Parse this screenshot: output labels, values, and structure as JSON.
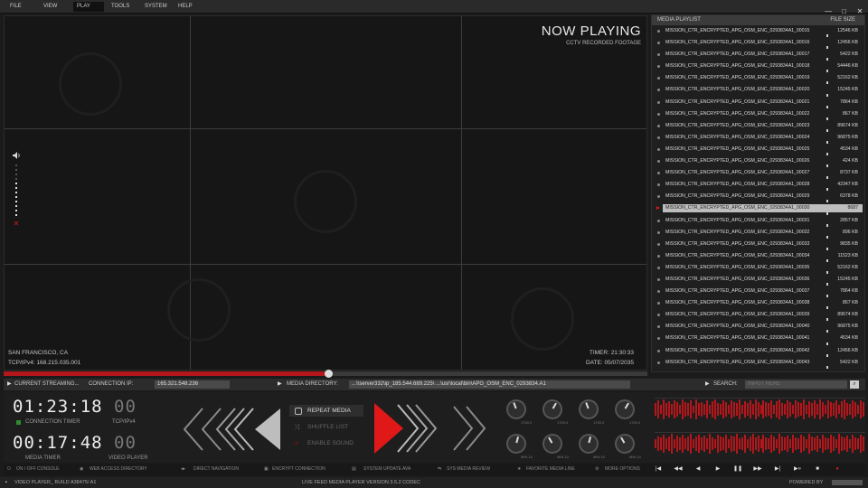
{
  "menu": [
    "FILE",
    "VIEW",
    "PLAY",
    "TOOLS",
    "SYSTEM",
    "HELP"
  ],
  "window_controls": [
    "—",
    "□",
    "✕"
  ],
  "now_playing": {
    "title": "NOW PLAYING",
    "subtitle": "CCTV RECORDED FOOTAGE"
  },
  "location": {
    "city": "SAN FRANCISCO, CA",
    "ip": "TCP/IPv4: 168.215.035.001"
  },
  "overlay_time": {
    "timer": "TIMER:   21:30:33",
    "date": "DATE:   05/07/2035"
  },
  "seek": {
    "progress": 0.504
  },
  "playlist": {
    "header": "MEDIA PLAYLIST",
    "size_header": "FILE SIZE",
    "selected_index": 15,
    "items": [
      {
        "name": "MISSION_CTR_ENCRYPTED_APG_OSM_ENC_0293834A1_00015",
        "size": "12546 KB"
      },
      {
        "name": "MISSION_CTR_ENCRYPTED_APG_OSM_ENC_0293834A1_00016",
        "size": "12456 KB"
      },
      {
        "name": "MISSION_CTR_ENCRYPTED_APG_OSM_ENC_0293834A1_00017",
        "size": "5422 KB"
      },
      {
        "name": "MISSION_CTR_ENCRYPTED_APG_OSM_ENC_0293834A1_00018",
        "size": "54446 KB"
      },
      {
        "name": "MISSION_CTR_ENCRYPTED_APG_OSM_ENC_0293834A1_00019",
        "size": "52162 KB"
      },
      {
        "name": "MISSION_CTR_ENCRYPTED_APG_OSM_ENC_0293834A1_00020",
        "size": "15245 KB"
      },
      {
        "name": "MISSION_CTR_ENCRYPTED_APG_OSM_ENC_0293834A1_00021",
        "size": "7864 KB"
      },
      {
        "name": "MISSION_CTR_ENCRYPTED_APG_OSM_ENC_0293834A1_00022",
        "size": "867 KB"
      },
      {
        "name": "MISSION_CTR_ENCRYPTED_APG_OSM_ENC_0293834A1_00023",
        "size": "89674 KB"
      },
      {
        "name": "MISSION_CTR_ENCRYPTED_APG_OSM_ENC_0293834A1_00024",
        "size": "96875 KB"
      },
      {
        "name": "MISSION_CTR_ENCRYPTED_APG_OSM_ENC_0293834A1_00025",
        "size": "4534 KB"
      },
      {
        "name": "MISSION_CTR_ENCRYPTED_APG_OSM_ENC_0293834A1_00026",
        "size": "424 KB"
      },
      {
        "name": "MISSION_CTR_ENCRYPTED_APG_OSM_ENC_0293834A1_00027",
        "size": "8737 KB"
      },
      {
        "name": "MISSION_CTR_ENCRYPTED_APG_OSM_ENC_0293834A1_00028",
        "size": "42347 KB"
      },
      {
        "name": "MISSION_CTR_ENCRYPTED_APG_OSM_ENC_0293834A1_00029",
        "size": "6378 KB"
      },
      {
        "name": "MISSION_CTR_ENCRYPTED_APG_OSM_ENC_0293834A1_00030",
        "size": "8687"
      },
      {
        "name": "MISSION_CTR_ENCRYPTED_APG_OSM_ENC_0293834A1_00031",
        "size": "2857 KB"
      },
      {
        "name": "MISSION_CTR_ENCRYPTED_APG_OSM_ENC_0293834A1_00032",
        "size": "896 KB"
      },
      {
        "name": "MISSION_CTR_ENCRYPTED_APG_OSM_ENC_0293834A1_00033",
        "size": "9835 KB"
      },
      {
        "name": "MISSION_CTR_ENCRYPTED_APG_OSM_ENC_0293834A1_00034",
        "size": "11523 KB"
      },
      {
        "name": "MISSION_CTR_ENCRYPTED_APG_OSM_ENC_0293834A1_00035",
        "size": "52162 KB"
      },
      {
        "name": "MISSION_CTR_ENCRYPTED_APG_OSM_ENC_0293834A1_00036",
        "size": "15245 KB"
      },
      {
        "name": "MISSION_CTR_ENCRYPTED_APG_OSM_ENC_0293834A1_00037",
        "size": "7864 KB"
      },
      {
        "name": "MISSION_CTR_ENCRYPTED_APG_OSM_ENC_0293834A1_00038",
        "size": "867 KB"
      },
      {
        "name": "MISSION_CTR_ENCRYPTED_APG_OSM_ENC_0293834A1_00039",
        "size": "89674 KB"
      },
      {
        "name": "MISSION_CTR_ENCRYPTED_APG_OSM_ENC_0293834A1_00040",
        "size": "96875 KB"
      },
      {
        "name": "MISSION_CTR_ENCRYPTED_APG_OSM_ENC_0293834A1_00041",
        "size": "4534 KB"
      },
      {
        "name": "MISSION_CTR_ENCRYPTED_APG_OSM_ENC_0293834A1_00042",
        "size": "12456 KB"
      },
      {
        "name": "MISSION_CTR_ENCRYPTED_APG_OSM_ENC_0293834A1_00043",
        "size": "5422 KB"
      }
    ]
  },
  "infobar": {
    "streaming_label": "CURRENT STREAMING...",
    "connection_label": "CONNECTION IP:",
    "connection_ip": "165.321.548.236",
    "directory_label": "MEDIA DIRECTORY:",
    "directory_path": "...\\\\server332\\ip_185.544.689.225\\ ...\\usr\\local\\bin\\APG_OSM_ENC_0293834.A1",
    "search_label": "SEARCH:",
    "search_placeholder": "INPUT HERE"
  },
  "timers": {
    "connection": {
      "h": "01",
      "m": "23",
      "s": "18",
      "f": "00",
      "label": "CONNECTION TIMER",
      "proto": "TCP/IPv4"
    },
    "media": {
      "h": "00",
      "m": "17",
      "s": "48",
      "f": "00",
      "label": "MEDIA TIMER",
      "player": "VIDEO PLAYER"
    }
  },
  "options": [
    {
      "label": "REPEAT MEDIA",
      "icon": "repeat-icon",
      "enabled": true
    },
    {
      "label": "SHUFFLE LIST",
      "icon": "shuffle-icon",
      "enabled": false
    },
    {
      "label": "ENABLE SOUND",
      "icon": "sound-icon",
      "enabled": false
    }
  ],
  "knobs_top": [
    "1700.0",
    "1700.0",
    "1700.0",
    "1700.0"
  ],
  "knobs_bottom": [
    "MIN 10",
    "MIN 10",
    "MIN 10",
    "MIN 10"
  ],
  "wave_top": [
    0.55,
    0.8,
    0.4,
    0.9,
    0.6,
    0.75,
    0.5,
    0.85,
    0.65,
    0.45,
    0.9,
    0.7,
    0.55,
    0.8,
    0.35,
    0.95,
    0.6,
    0.7,
    0.5,
    0.85,
    0.4,
    0.75,
    0.9,
    0.6,
    0.5,
    0.8,
    0.65,
    0.45,
    0.85,
    0.7,
    0.55,
    0.9,
    0.4,
    0.75,
    0.6,
    0.8,
    0.5,
    0.95,
    0.65,
    0.45,
    0.8,
    0.7,
    0.55,
    0.85,
    0.4,
    0.75,
    0.9,
    0.6,
    0.5,
    0.8,
    0.65,
    0.45,
    0.85,
    0.7,
    0.55,
    0.9,
    0.4,
    0.75,
    0.6,
    0.8,
    0.5,
    0.95,
    0.65,
    0.45,
    0.8,
    0.7,
    0.55,
    0.85,
    0.4,
    0.75,
    0.9,
    0.6,
    0.5,
    0.8,
    0.65,
    0.45,
    0.85,
    0.7
  ],
  "wave_bottom": [
    0.4,
    0.7,
    0.55,
    0.85,
    0.5,
    0.65,
    0.9,
    0.45,
    0.75,
    0.6,
    0.8,
    0.5,
    0.7,
    0.95,
    0.4,
    0.65,
    0.85,
    0.55,
    0.75,
    0.5,
    0.9,
    0.6,
    0.45,
    0.8,
    0.7,
    0.55,
    0.85,
    0.4,
    0.75,
    0.65,
    0.9,
    0.5,
    0.6,
    0.8,
    0.45,
    0.7,
    0.95,
    0.55,
    0.75,
    0.4,
    0.85,
    0.6,
    0.5,
    0.8,
    0.65,
    0.45,
    0.9,
    0.7,
    0.55,
    0.75,
    0.4,
    0.85,
    0.6,
    0.5,
    0.8,
    0.65,
    0.45,
    0.9,
    0.7,
    0.55,
    0.75,
    0.4,
    0.85,
    0.6,
    0.5,
    0.8,
    0.65,
    0.45,
    0.9,
    0.7,
    0.55,
    0.75,
    0.4,
    0.85,
    0.6,
    0.5,
    0.8,
    0.65
  ],
  "status_items": [
    "ON / OFF CONSOLE",
    "WEB ACCESS DIRECTORY",
    "DIRECT NAVIGATION",
    "ENCRYPT CONNECTION",
    "SYSTEM UPDATE AVA",
    "SYS MEDIA REVIEW",
    "FAVORITE MEDIA LINE",
    "MORE OPTIONS"
  ],
  "transport": [
    "|◀",
    "◀◀",
    "◀",
    "▶",
    "❚❚",
    "▶▶",
    "▶|",
    "▶»",
    "■",
    "●"
  ],
  "footer": {
    "left": "VIDEO PLAYER_ BUILD A38475/ A1",
    "center": "LIVE FEED MEDIA PLAYER VERSION 3.5.2 CODEC",
    "right": "POWERED BY"
  },
  "colors": {
    "accent": "#d11b1b",
    "bg": "#1b1b1b"
  }
}
